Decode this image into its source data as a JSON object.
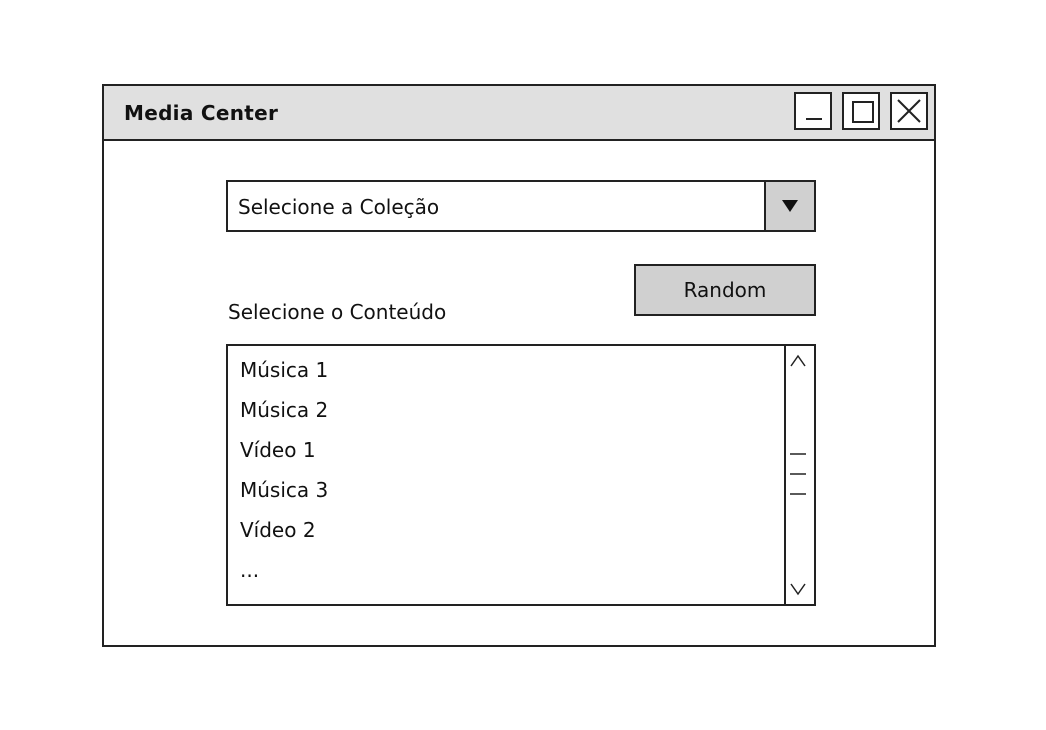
{
  "window": {
    "title": "Media Center",
    "controls": {
      "minimize": "minimize-icon",
      "maximize": "maximize-icon",
      "close": "close-icon"
    }
  },
  "collection_select": {
    "selected_value": "Selecione a Coleção",
    "icon": "dropdown-arrow-icon"
  },
  "random_button": {
    "label": "Random"
  },
  "content_list": {
    "label": "Selecione o Conteúdo",
    "items": [
      "Música 1",
      "Música 2",
      "Vídeo 1",
      "Música 3",
      "Vídeo 2",
      "..."
    ],
    "scrollbar": {
      "up_icon": "chevron-up-icon",
      "down_icon": "chevron-down-icon",
      "thumb_icon": "scroll-grip-icon"
    }
  },
  "colors": {
    "titlebar_bg": "#e0e0e0",
    "button_bg": "#d0d0d0",
    "border": "#222222"
  }
}
